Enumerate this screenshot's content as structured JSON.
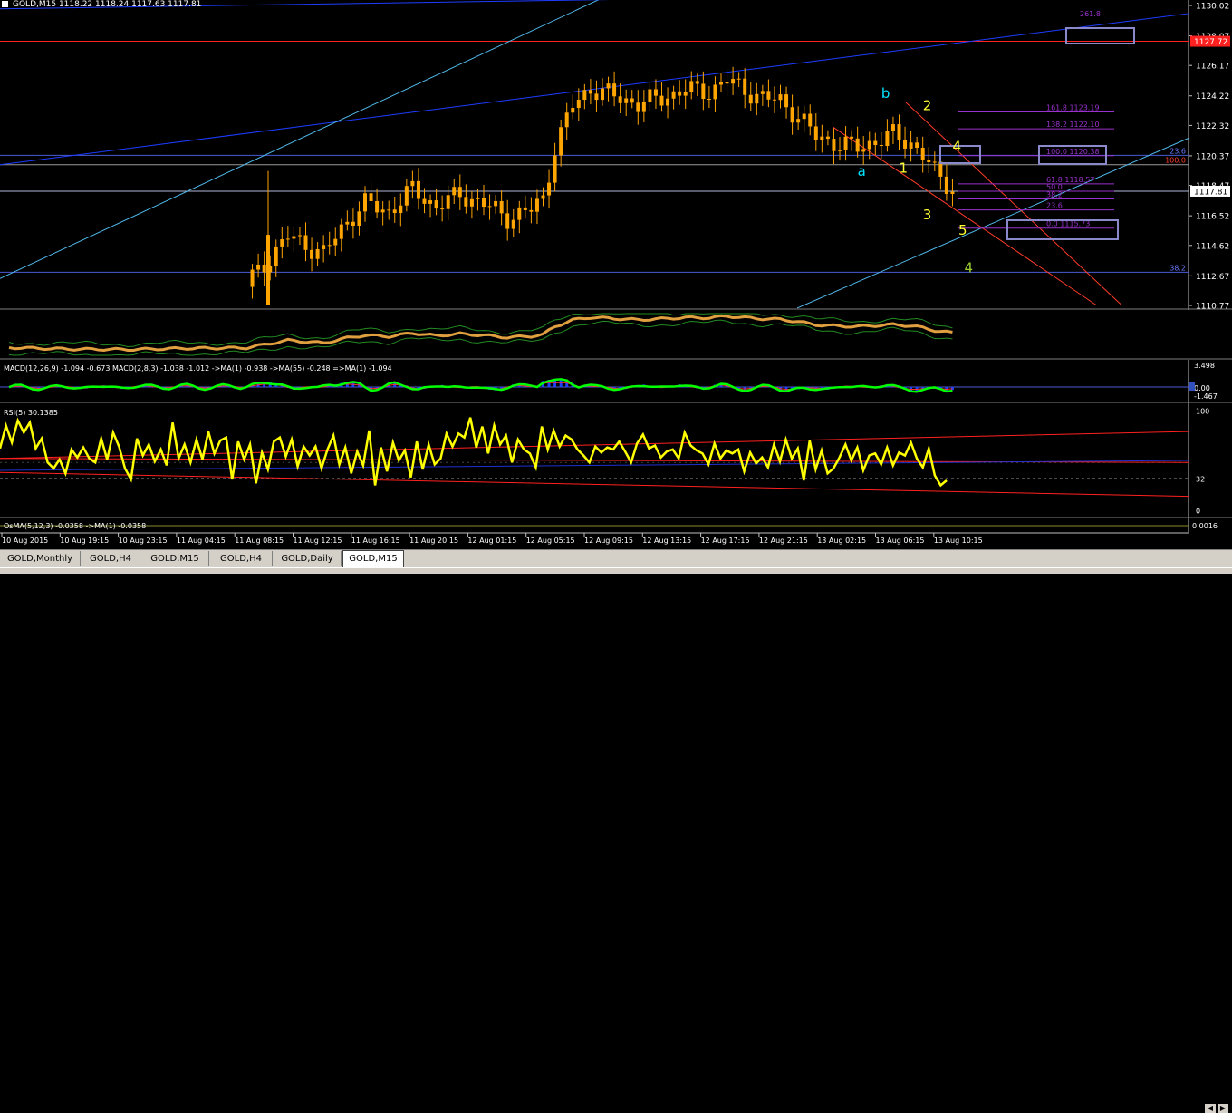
{
  "chart_data": [
    {
      "type": "candlestick",
      "title": "GOLD,M15  1118.22 1118.24 1117.63 1117.81",
      "symbol": "GOLD,M15",
      "ohlc_header": "1118.22 1118.24 1117.63 1117.81",
      "ylim": [
        1110.77,
        1130.02
      ],
      "price_ticks": [
        "1130.02",
        "1128.07",
        "1126.17",
        "1124.22",
        "1122.32",
        "1120.37",
        "1118.47",
        "1116.52",
        "1114.62",
        "1112.67",
        "1110.77"
      ],
      "current_price": "1117.81",
      "red_level_price": "1127.72",
      "x_ticks": [
        "10 Aug 2015",
        "10 Aug 19:15",
        "10 Aug 23:15",
        "11 Aug 04:15",
        "11 Aug 08:15",
        "11 Aug 12:15",
        "11 Aug 16:15",
        "11 Aug 20:15",
        "12 Aug 01:15",
        "12 Aug 05:15",
        "12 Aug 09:15",
        "12 Aug 13:15",
        "12 Aug 17:15",
        "12 Aug 21:15",
        "13 Aug 02:15",
        "13 Aug 06:15",
        "13 Aug 10:15"
      ],
      "close_path": [
        [
          0,
          1112.2
        ],
        [
          10,
          1111.6
        ],
        [
          20,
          1111.4
        ],
        [
          30,
          1111.9
        ],
        [
          40,
          1112.1
        ],
        [
          47,
          1115.2
        ],
        [
          53,
          1114.1
        ],
        [
          57,
          1116.2
        ],
        [
          60,
          1117.3
        ],
        [
          64,
          1116.8
        ],
        [
          68,
          1118.2
        ],
        [
          72,
          1117.1
        ],
        [
          76,
          1117.9
        ],
        [
          80,
          1117.3
        ],
        [
          84,
          1116.4
        ],
        [
          88,
          1116.9
        ],
        [
          90,
          1117.6
        ],
        [
          92,
          1120.9
        ],
        [
          95,
          1123.6
        ],
        [
          98,
          1124.7
        ],
        [
          102,
          1124.2
        ],
        [
          106,
          1123.7
        ],
        [
          110,
          1124.1
        ],
        [
          114,
          1124.6
        ],
        [
          118,
          1124.5
        ],
        [
          121,
          1125.2
        ],
        [
          124,
          1124.6
        ],
        [
          127,
          1124.1
        ],
        [
          130,
          1123.9
        ],
        [
          133,
          1122.9
        ],
        [
          136,
          1121.6
        ],
        [
          140,
          1121.1
        ],
        [
          143,
          1120.9
        ],
        [
          146,
          1121.3
        ],
        [
          149,
          1121.7
        ],
        [
          152,
          1121.2
        ],
        [
          154,
          1120.4
        ],
        [
          156,
          1119.3
        ],
        [
          158,
          1118.6
        ],
        [
          159,
          1118.3
        ]
      ],
      "fib_levels": [
        {
          "label": "261.8",
          "value": 1129.2
        },
        {
          "label": "161.8 1123.19",
          "value": 1123.19
        },
        {
          "label": "138.2 1122.10",
          "value": 1122.1
        },
        {
          "label": "100.0 1120.38",
          "value": 1120.38
        },
        {
          "label": "61.8 1118.57",
          "value": 1118.57
        },
        {
          "label": "50.0",
          "value": 1118.1
        },
        {
          "label": "38.2",
          "value": 1117.6
        },
        {
          "label": "23.6",
          "value": 1116.9
        },
        {
          "label": "0.0 1115.73",
          "value": 1115.73
        }
      ],
      "level_labels": [
        {
          "label": "23.6",
          "value": 1120.4
        },
        {
          "label": "100.0",
          "value": 1119.8
        },
        {
          "label": "38.2",
          "value": 1112.9
        }
      ],
      "wave_labels": [
        {
          "text": "b",
          "color": "#00e5ff",
          "x": 147,
          "y": 1124.1
        },
        {
          "text": "2",
          "color": "#ffff33",
          "x": 154,
          "y": 1123.3
        },
        {
          "text": "a",
          "color": "#00e5ff",
          "x": 143,
          "y": 1119.1
        },
        {
          "text": "1",
          "color": "#ffff33",
          "x": 150,
          "y": 1119.3
        },
        {
          "text": "4",
          "color": "#ffff33",
          "x": 159,
          "y": 1120.7
        },
        {
          "text": "3",
          "color": "#ffff33",
          "x": 154,
          "y": 1116.3
        },
        {
          "text": "5",
          "color": "#ffff33",
          "x": 160,
          "y": 1115.3
        },
        {
          "text": "4",
          "color": "#9acd32",
          "x": 161,
          "y": 1112.9
        }
      ]
    },
    {
      "type": "line",
      "title": "MACD(12,26,9) -1.094 -0.673  MACD(2,8,3) -1.038 -1.012  ->MA(1) -0.938  ->MA(55) -0.248  =>MA(1) -1.094",
      "ylim": [
        -1.467,
        3.498
      ],
      "ticks": [
        "3.498",
        "0.00",
        "-1.467"
      ]
    },
    {
      "type": "line",
      "title": "RSI(5) 30.1385",
      "ylim": [
        0,
        100
      ],
      "ticks": [
        "100",
        "32",
        "0"
      ],
      "values": [
        62,
        85,
        68,
        90,
        78,
        88,
        62,
        72,
        48,
        42,
        51,
        37,
        61,
        53,
        63,
        52,
        48,
        72,
        51,
        78,
        64,
        42,
        31,
        72,
        55,
        66,
        49,
        61,
        45,
        88,
        52,
        66,
        48,
        71,
        51,
        79,
        57,
        70,
        73,
        31,
        69,
        51,
        66,
        27,
        58,
        41,
        69,
        73,
        54,
        71,
        44,
        64,
        55,
        64,
        42,
        61,
        75,
        46,
        63,
        37,
        59,
        45,
        80,
        25,
        63,
        39,
        68,
        50,
        60,
        33,
        69,
        41,
        66,
        46,
        52,
        77,
        64,
        77,
        73,
        93,
        63,
        84,
        57,
        85,
        66,
        75,
        48,
        71,
        61,
        57,
        43,
        84,
        61,
        80,
        64,
        75,
        71,
        61,
        55,
        48,
        64,
        58,
        63,
        61,
        69,
        59,
        48,
        67,
        76,
        62,
        65,
        53,
        59,
        61,
        52,
        78,
        65,
        60,
        57,
        46,
        67,
        52,
        60,
        57,
        61,
        39,
        58,
        47,
        53,
        43,
        66,
        49,
        71,
        52,
        62,
        30,
        70,
        41,
        60,
        37,
        42,
        53,
        66,
        50,
        63,
        40,
        55,
        57,
        46,
        63,
        45,
        58,
        55,
        68,
        52,
        43,
        62,
        35,
        25,
        30
      ],
      "current": "30.1385"
    },
    {
      "type": "line",
      "title": "OsMA(5,12,3) -0.0358  ->MA(1) -0.0358",
      "ticks": [
        "0.0016"
      ]
    }
  ],
  "tabs": [
    {
      "label": "GOLD,Monthly",
      "active": false
    },
    {
      "label": "GOLD,H4",
      "active": false
    },
    {
      "label": "GOLD,M15",
      "active": false
    },
    {
      "label": "GOLD,H4",
      "active": false
    },
    {
      "label": "GOLD,Daily",
      "active": false
    },
    {
      "label": "GOLD,M15",
      "active": true
    }
  ],
  "colors": {
    "background": "#000000",
    "grid": "#555555",
    "axis": "#c0c0c0",
    "bull": "#ffa500",
    "rsi": "#ffff00",
    "macd": "#00ff00",
    "fib": "#9932cc",
    "trend_blue": "#1e3cff",
    "trend_cyan": "#4fb7e8",
    "level_red": "#ff2020"
  }
}
